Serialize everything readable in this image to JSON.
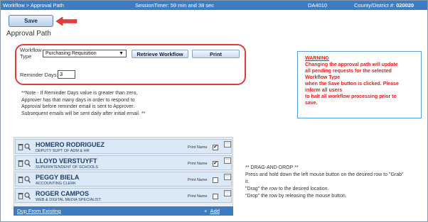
{
  "topbar": {
    "breadcrumb": "Workflow > Approval Path",
    "session_timer": "SessionTimer: 59 min and 38 sec",
    "screen_code": "DA4010",
    "district_label": "County/District #:",
    "district_value": "020020",
    "color": "#3d7cc0"
  },
  "toolbar": {
    "save_label": "Save"
  },
  "page": {
    "title": "Approval Path"
  },
  "workflow": {
    "type_label_line1": "Workflow",
    "type_label_line2": "Type",
    "type_value": "Purchasing Requisition",
    "retrieve_label": "Retrieve Workflow",
    "print_label": "Print",
    "reminder_label": "Reminder Days:",
    "reminder_value": "3"
  },
  "note": {
    "line1": "**Note - If Reminder Days value is greater than zero,",
    "line2": "Approver has that many days in order to respond to",
    "line3": "Approval before reminder email is sent to Approver.",
    "line4": "Subsequent emails will be sent daily after initial email. **"
  },
  "warning": {
    "title": "WARNING",
    "lines": [
      "Changing the approval path will update",
      "all pending requests for the selected",
      "Workflow Type",
      "when the Save button is clicked. Please",
      "inform all users",
      "to halt all workflow processing prior to",
      "save."
    ],
    "color": "#e02020"
  },
  "approvers": [
    {
      "name": "HOMERO RODRIGUEZ",
      "title": "DEPUTY SUPT OF ADM & HR",
      "print_label": "Print Name",
      "print_checked": true
    },
    {
      "name": "LLOYD VERSTUYFT",
      "title": "SUPERINTENDENT OF SCHOOLS",
      "print_label": "Print Name",
      "print_checked": true
    },
    {
      "name": "PEGGY BIELA",
      "title": "ACCOUNTING CLERK",
      "print_label": "Print Name",
      "print_checked": false
    },
    {
      "name": "ROGER CAMPOS",
      "title": "WEB & DIGITAL MEDIA SPECIALIST",
      "print_label": "Print Name",
      "print_checked": false
    }
  ],
  "list_footer": {
    "dup_label": "Dup From Existing",
    "add_symbol": "+",
    "add_label": "Add"
  },
  "dnd_help": {
    "title": "** DRAG-AND-DROP **",
    "line1": "Press and hold down the left mouse button on the desired row to \"Grab\"",
    "line2": "it.",
    "line3": "\"Drag\" the row to the desired location.",
    "line4": "\"Drop\" the row by releasing the mouse button."
  },
  "icons": [
    "trash-icon",
    "search-icon",
    "arrow-left-icon",
    "more-icon"
  ]
}
